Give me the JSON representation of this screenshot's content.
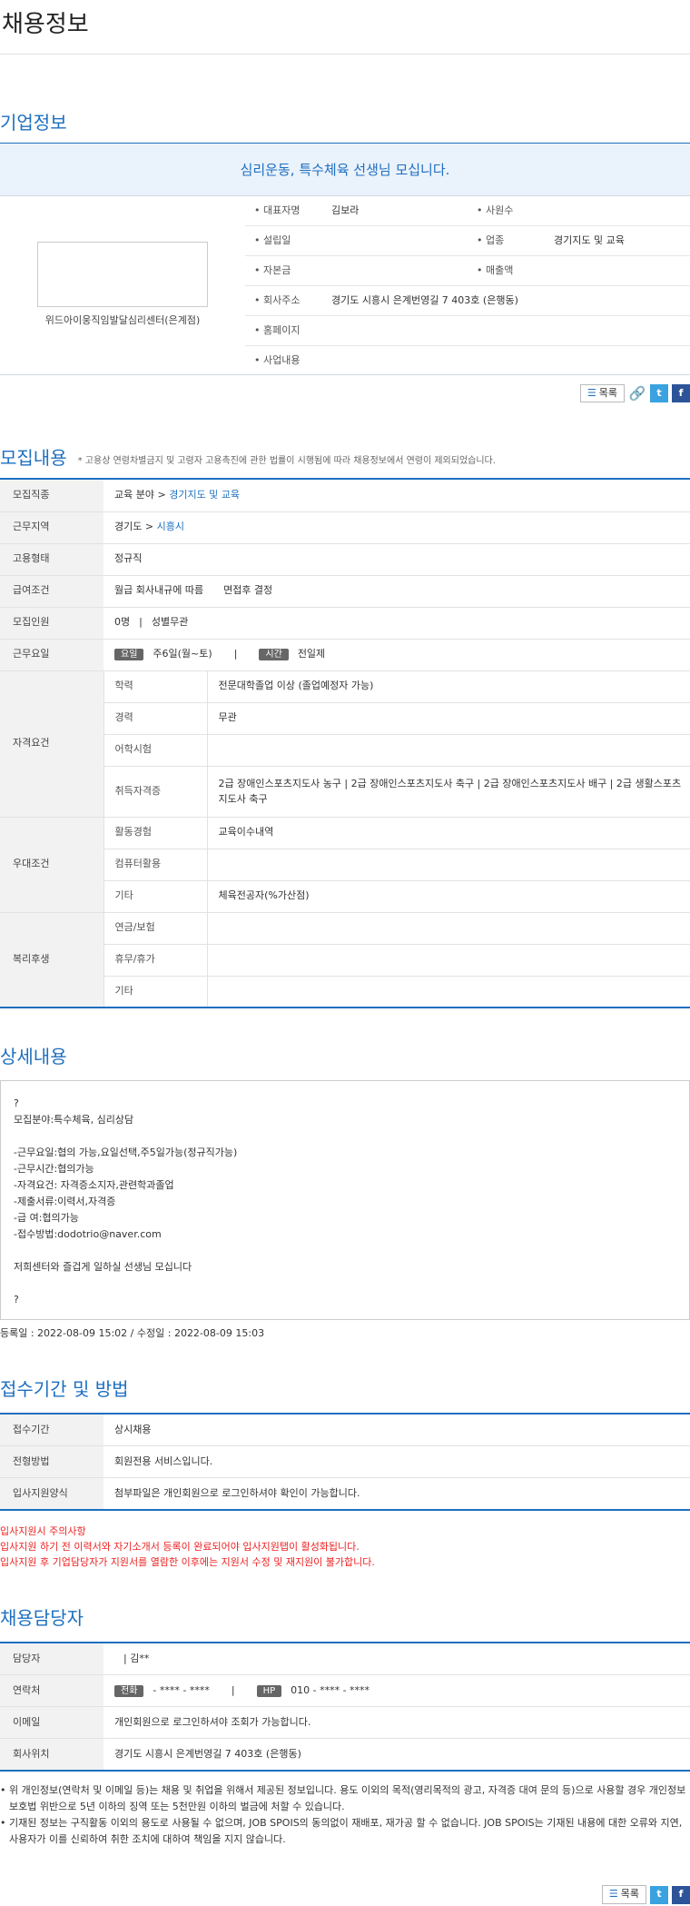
{
  "page_title": "채용정보",
  "company_section": {
    "title": "기업정보",
    "banner": "심리운동, 특수체육 선생님 모십니다.",
    "company_name": "위드아이웅직임발달심리센터(은계점)",
    "fields": {
      "ceo_label": "대표자명",
      "ceo_value": "김보라",
      "employees_label": "사원수",
      "employees_value": "",
      "founded_label": "설립일",
      "founded_value": "",
      "industry_label": "업종",
      "industry_value": "경기지도 및 교육",
      "capital_label": "자본금",
      "capital_value": "",
      "sales_label": "매출액",
      "sales_value": "",
      "address_label": "회사주소",
      "address_value": "경기도 시흥시 은계번영길 7 403호 (은행동)",
      "homepage_label": "홈페이지",
      "homepage_value": "",
      "business_label": "사업내용",
      "business_value": ""
    },
    "list_button": "목록",
    "twitter": "t",
    "facebook": "f"
  },
  "recruit_section": {
    "title": "모집내용",
    "note": "* 고용상 연령차별금지 및 고령자 고용촉진에 관한 법률이 시행됨에 따라 채용정보에서 연령이 제외되었습니다.",
    "job_label": "모집직종",
    "job_prefix": "교육 분야 >",
    "job_link": "경기지도 및 교육",
    "region_label": "근무지역",
    "region_prefix": "경기도 >",
    "region_link": "시흥시",
    "type_label": "고용형태",
    "type_value": "정규직",
    "pay_label": "급여조건",
    "pay_value": "월급 회사내규에 따름",
    "pay_extra": "면접후 결정",
    "headcount_label": "모집인원",
    "headcount_value": "0명",
    "headcount_sep": "|",
    "gender_value": "성별무관",
    "days_label": "근무요일",
    "days_tag": "요일",
    "days_value": "주6일(월~토)",
    "days_sep": "|",
    "time_tag": "시간",
    "time_value": "전일제",
    "qual_label": "자격요건",
    "edu_label": "학력",
    "edu_value": "전문대학졸업 이상 (졸업예정자 가능)",
    "career_label": "경력",
    "career_value": "무관",
    "lang_label": "어학시험",
    "lang_value": "",
    "cert_label": "취득자격증",
    "cert_value": "2급 장애인스포츠지도사 농구 | 2급 장애인스포츠지도사 축구 | 2급 장애인스포츠지도사 배구 | 2급 생활스포츠지도사 축구",
    "pref_label": "우대조건",
    "activity_label": "활동경험",
    "activity_value": "교육이수내역",
    "computer_label": "컴퓨터활용",
    "computer_value": "",
    "etc_label": "기타",
    "etc_value": "체육전공자(%가산점)",
    "welfare_label": "복리후생",
    "pension_label": "연금/보험",
    "pension_value": "",
    "leave_label": "휴무/휴가",
    "leave_value": "",
    "welfare_etc_label": "기타",
    "welfare_etc_value": ""
  },
  "detail_section": {
    "title": "상세내용",
    "lines": [
      "?",
      "모집분야:특수체육, 심리상담",
      "",
      "-근무요일:협의 가능,요일선택,주5일가능(정규직가능)",
      "-근무시간:협의가능",
      "-자격요건: 자격증소지자,관련학과졸업",
      "-제출서류:이력서,자격증",
      "-급 여:협의가능",
      "-접수방법:dodotrio@naver.com",
      "",
      "저희센터와 즐겁게 일하실 선생님 모십니다",
      "",
      "?"
    ],
    "registered": "등록일 : 2022-08-09 15:02 / 수정일 : 2022-08-09 15:03"
  },
  "apply_section": {
    "title": "접수기간 및 방법",
    "period_label": "접수기간",
    "period_value": "상시채용",
    "method_label": "전형방법",
    "method_value": "회원전용 서비스입니다.",
    "form_label": "입사지원양식",
    "form_value": "첨부파일은 개인회원으로 로그인하셔야 확인이 가능합니다.",
    "warn1": "입사지원시 주의사항",
    "warn2": "입사지원 하기 전 이력서와 자기소개서 등록이 완료되어야 입사지원탭이 활성화됩니다.",
    "warn3": "입사지원 후 기업담당자가 지원서를 열람한 이후에는 지원서 수정 및 재지원이 불가합니다."
  },
  "contact_section": {
    "title": "채용담당자",
    "person_label": "담당자",
    "person_value": "| 김**",
    "phone_label": "연락처",
    "phone_tag": "전화",
    "phone_value": "- **** - ****",
    "phone_sep": "|",
    "hp_tag": "HP",
    "hp_value": "010 - **** - ****",
    "email_label": "이메일",
    "email_value": "개인회원으로 로그인하셔야 조회가 가능합니다.",
    "location_label": "회사위치",
    "location_value": "경기도 시흥시 은계번영길 7 403호 (은행동)",
    "notice1": "위 개인정보(연락처 및 이메일 등)는 채용 및 취업을 위해서 제공된 정보입니다. 용도 이외의 목적(영리목적의 광고, 자격증 대여 문의 등)으로 사용할 경우 개인정보보호법 위반으로 5년 이하의 징역 또는 5천만원 이하의 벌금에 처할 수 있습니다.",
    "notice2": "기재된 정보는 구직활동 이외의 용도로 사용될 수 없으며, JOB SPOIS의 동의없이 재배포, 재가공 할 수 없습니다. JOB SPOIS는 기재된 내용에 대한 오류와 지연, 사용자가 이를 신뢰하여 취한 조치에 대하여 책임을 지지 않습니다."
  }
}
